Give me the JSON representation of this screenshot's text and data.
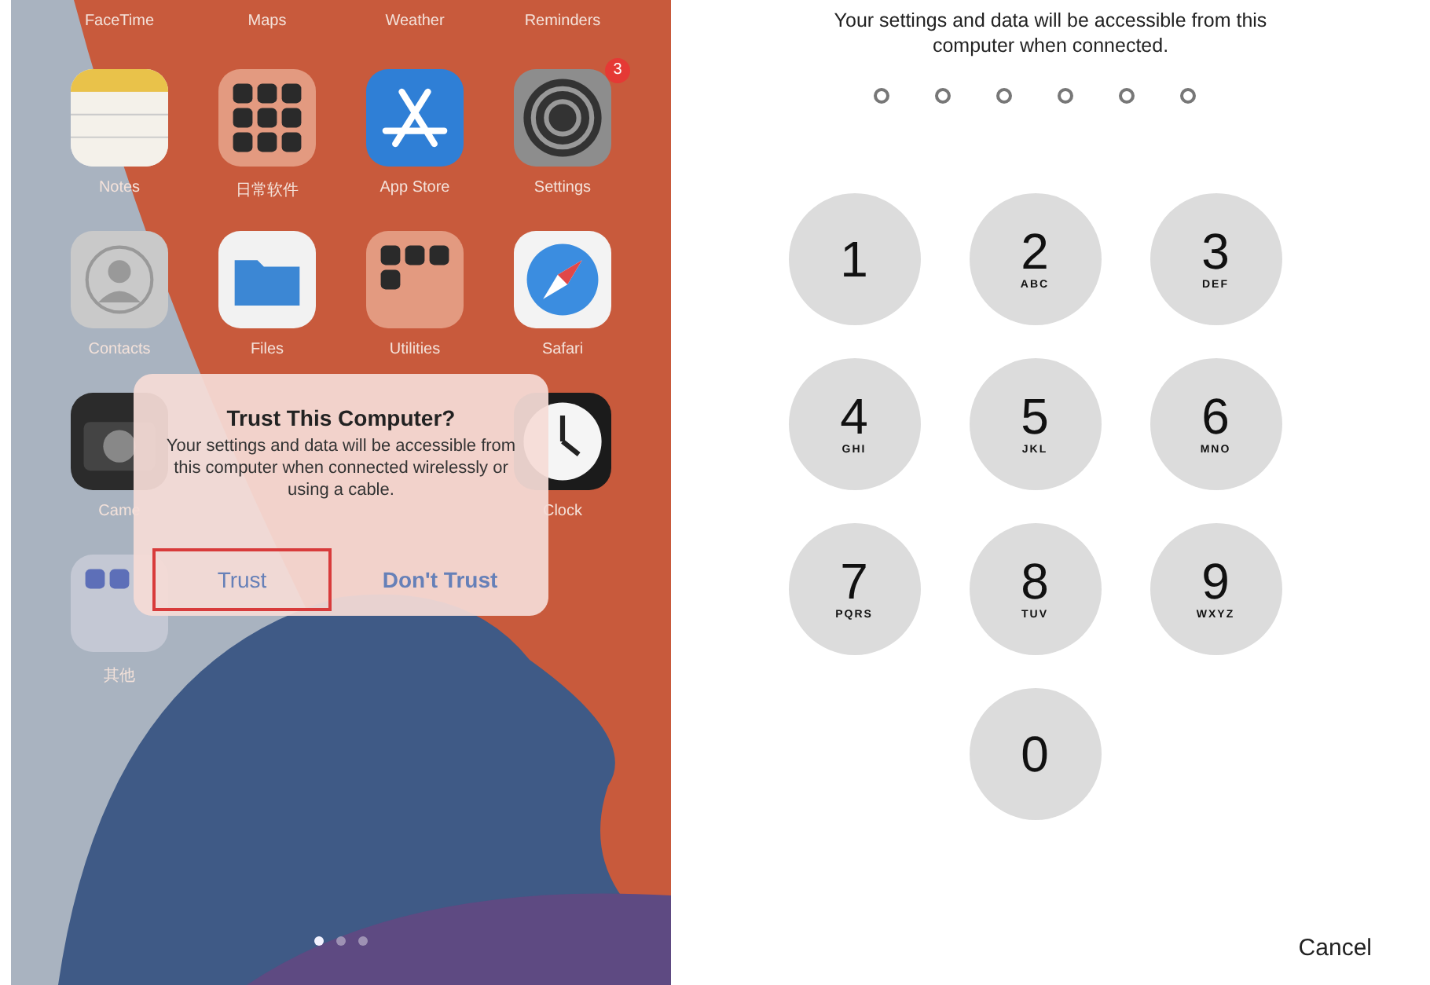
{
  "home_screen": {
    "top_labels": [
      "FaceTime",
      "Maps",
      "Weather",
      "Reminders"
    ],
    "rows": [
      {
        "apps": [
          {
            "kind": "notes",
            "label": "Notes"
          },
          {
            "kind": "folder",
            "label": "日常软件"
          },
          {
            "kind": "appstore",
            "label": "App Store"
          },
          {
            "kind": "settings",
            "label": "Settings",
            "badge": "3"
          }
        ]
      },
      {
        "apps": [
          {
            "kind": "contacts",
            "label": "Contacts"
          },
          {
            "kind": "files",
            "label": "Files"
          },
          {
            "kind": "utilities",
            "label": "Utilities"
          },
          {
            "kind": "safari",
            "label": "Safari"
          }
        ]
      },
      {
        "apps": [
          {
            "kind": "camera",
            "label": "Came"
          },
          {
            "kind": "clock",
            "label": "Clock"
          }
        ]
      },
      {
        "apps": [
          {
            "kind": "folder2",
            "label": "其他"
          }
        ]
      }
    ],
    "page_dots": [
      {
        "selected": true
      },
      {
        "selected": false
      },
      {
        "selected": false
      }
    ]
  },
  "dialog": {
    "title": "Trust This Computer?",
    "message": "Your settings and data will be accessible from this computer when connected wirelessly or using a cable.",
    "buttons": [
      {
        "label": "Trust",
        "highlighted": true
      },
      {
        "label": "Don't Trust",
        "highlighted": false
      }
    ]
  },
  "passcode": {
    "message": "Your settings and data will be accessible from this computer when connected.",
    "digits": [
      {
        "filled": false
      },
      {
        "filled": false
      },
      {
        "filled": false
      },
      {
        "filled": false
      },
      {
        "filled": false
      },
      {
        "filled": false
      }
    ],
    "keys": [
      {
        "digit": "1"
      },
      {
        "digit": "2",
        "letters": "ABC"
      },
      {
        "digit": "3",
        "letters": "DEF"
      },
      {
        "digit": "4",
        "letters": "GHI"
      },
      {
        "digit": "5",
        "letters": "JKL"
      },
      {
        "digit": "6",
        "letters": "MNO"
      },
      {
        "digit": "7",
        "letters": "PQRS"
      },
      {
        "digit": "8",
        "letters": "TUV"
      },
      {
        "digit": "9",
        "letters": "WXYZ"
      },
      {
        "digit": "0"
      }
    ],
    "cancel": "Cancel"
  }
}
